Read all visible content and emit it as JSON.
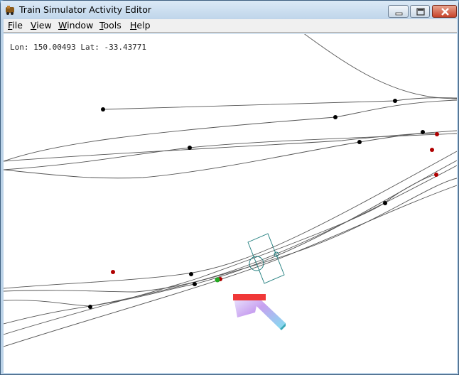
{
  "window": {
    "title": "Train Simulator Activity Editor",
    "app_icon": "train-app-icon",
    "controls": {
      "minimize": "minimize-icon",
      "maximize": "maximize-icon",
      "close": "close-icon"
    }
  },
  "menu": {
    "items": [
      {
        "label": "File"
      },
      {
        "label": "View"
      },
      {
        "label": "Window"
      },
      {
        "label": "Tools"
      },
      {
        "label": "Help"
      }
    ]
  },
  "map": {
    "coordinates": "Lon: 150.00493 Lat: -33.43771",
    "colors": {
      "track": "#555555",
      "junction": "#000000",
      "signal": "#b00000",
      "start_marker": "#22aa22",
      "selection": "#1a7a7a",
      "arrow_red": "#f03838",
      "arrow_body": "#c8a0f0",
      "arrow_tip": "#80e0f0"
    }
  }
}
